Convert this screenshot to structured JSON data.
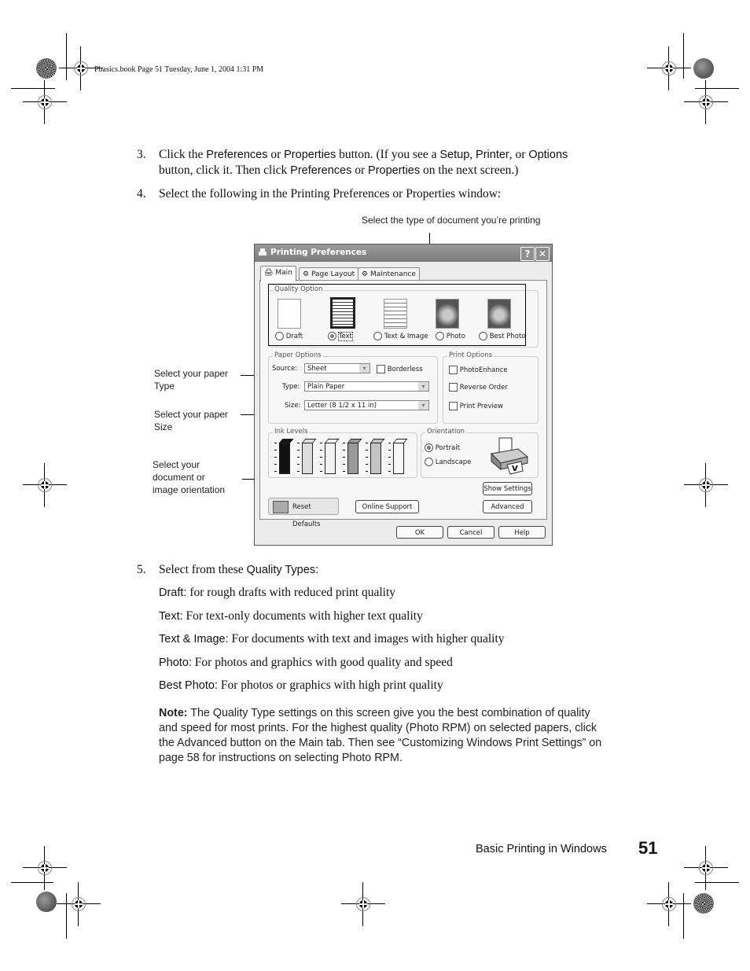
{
  "slug": "Pbasics.book  Page 51  Tuesday, June 1, 2004  1:31 PM",
  "steps": {
    "s3": {
      "num": "3.",
      "t1": "Click the ",
      "u1": "Preferences",
      "t2": " or ",
      "u2": "Properties",
      "t3": " button. (If you see a ",
      "u3": "Setup",
      "t4": ", ",
      "u4": "Printer",
      "t5": ", or ",
      "u5": "Options",
      "t6": "button, click it. Then click ",
      "u6": "Preferences",
      "t7": " or ",
      "u7": "Properties",
      "t8": " on the next screen.)"
    },
    "s4": {
      "num": "4.",
      "text": "Select the following in the Printing Preferences or Properties window:"
    },
    "s5": {
      "num": "5.",
      "t1": "Select from these ",
      "u1": "Quality Types:"
    }
  },
  "callouts": {
    "doc_type": "Select the type of document you’re printing",
    "paper_type_1": "Select your paper",
    "paper_type_2": "Type",
    "paper_size_1": "Select your paper",
    "paper_size_2": "Size",
    "orient_1": "Select your",
    "orient_2": "document or",
    "orient_3": "image orientation"
  },
  "dialog": {
    "title": "Printing Preferences",
    "help_btn": "?",
    "close_btn": "✕",
    "tabs": [
      {
        "label": "Main",
        "active": true
      },
      {
        "label": "Page Layout",
        "active": false
      },
      {
        "label": "Maintenance",
        "active": false
      }
    ],
    "quality": {
      "label": "Quality Option",
      "options": [
        {
          "label": "Draft",
          "selected": false
        },
        {
          "label": "Text",
          "selected": true
        },
        {
          "label": "Text & Image",
          "selected": false
        },
        {
          "label": "Photo",
          "selected": false
        },
        {
          "label": "Best Photo",
          "selected": false
        }
      ]
    },
    "paper": {
      "label": "Paper Options",
      "source_label": "Source:",
      "source_value": "Sheet",
      "borderless_label": "Borderless",
      "type_label": "Type:",
      "type_value": "Plain Paper",
      "size_label": "Size:",
      "size_value": "Letter (8 1/2 x 11 in)"
    },
    "print_options": {
      "label": "Print Options",
      "items": [
        "PhotoEnhance",
        "Reverse Order",
        "Print Preview"
      ]
    },
    "ink": {
      "label": "Ink Levels",
      "colors": [
        "#111111",
        "#dddddd",
        "#f2f2f2",
        "#999999",
        "#c4c4c4",
        "#f6f6f6"
      ]
    },
    "orientation": {
      "label": "Orientation",
      "options": [
        {
          "label": "Portrait",
          "selected": true
        },
        {
          "label": "Landscape",
          "selected": false
        }
      ]
    },
    "buttons": {
      "reset": "Reset Defaults",
      "online": "Online Support",
      "show_settings": "Show Settings",
      "advanced": "Advanced",
      "ok": "OK",
      "cancel": "Cancel",
      "help": "Help"
    }
  },
  "quality_types": [
    {
      "name": "Draft:",
      "desc": " for rough drafts with reduced print quality"
    },
    {
      "name": "Text:",
      "desc": " For text-only documents with higher text quality"
    },
    {
      "name": "Text & Image:",
      "desc": " For documents with text and images with higher quality"
    },
    {
      "name": "Photo:",
      "desc": " For photos and graphics with good quality and speed"
    },
    {
      "name": "Best Photo:",
      "desc": " For photos or graphics with high print quality"
    }
  ],
  "note": {
    "label": "Note:",
    "text": " The Quality Type settings on this screen give you the best combination of quality and speed for most prints. For the highest quality (Photo RPM) on selected papers, click the Advanced button on the Main tab. Then see “Customizing Windows Print Settings” on page 58 for instructions on selecting Photo RPM."
  },
  "footer": {
    "section": "Basic Printing in Windows",
    "page": "51"
  }
}
